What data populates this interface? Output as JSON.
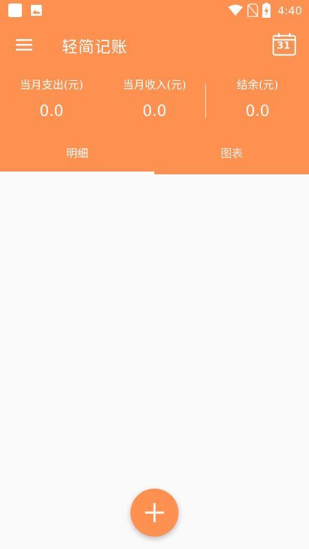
{
  "status_bar": {
    "time": "4:40",
    "left_icons": [
      "app-notification-icon",
      "image-icon"
    ],
    "right_icons": [
      "wifi-icon",
      "no-sim-icon",
      "battery-charging-icon"
    ]
  },
  "app_bar": {
    "title": "轻简记账",
    "menu_icon": "menu-icon",
    "calendar_day": "31"
  },
  "summary": {
    "expense_label": "当月支出(元)",
    "expense_value": "0.0",
    "income_label": "当月收入(元)",
    "income_value": "0.0",
    "balance_label": "结余(元)",
    "balance_value": "0.0"
  },
  "tabs": [
    {
      "label": "明细",
      "selected": true
    },
    {
      "label": "图表",
      "selected": false
    }
  ],
  "fab": {
    "icon": "plus-icon"
  },
  "colors": {
    "primary": "#ff9150",
    "background": "#fafafa",
    "on_primary": "#ffffff"
  }
}
